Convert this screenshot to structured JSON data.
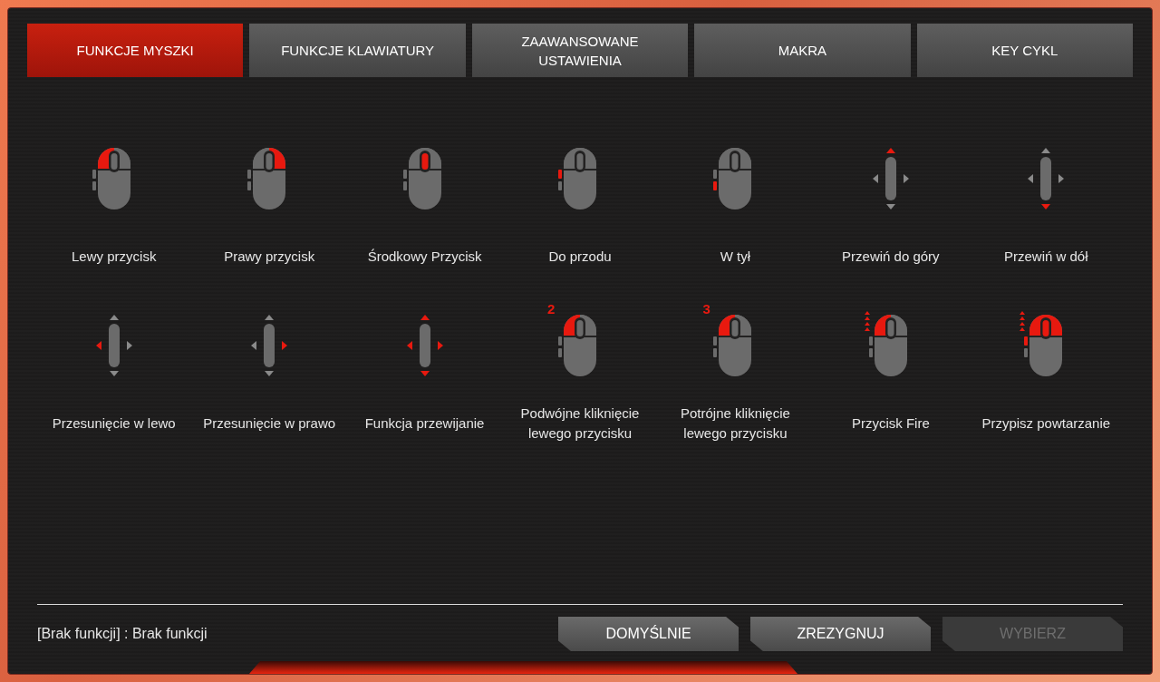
{
  "tabs": [
    {
      "label": "FUNKCJE MYSZKI",
      "selected": true
    },
    {
      "label": "FUNKCJE KLAWIATURY",
      "selected": false
    },
    {
      "label": "ZAAWANSOWANE USTAWIENIA",
      "selected": false
    },
    {
      "label": "MAKRA",
      "selected": false
    },
    {
      "label": "KEY CYKL",
      "selected": false
    }
  ],
  "functions": [
    {
      "label": "Lewy przycisk",
      "icon": {
        "kind": "mouse",
        "left": true,
        "right": false,
        "wheel": false,
        "forward": false,
        "back": false,
        "fire": false
      }
    },
    {
      "label": "Prawy przycisk",
      "icon": {
        "kind": "mouse",
        "left": false,
        "right": true,
        "wheel": false,
        "forward": false,
        "back": false,
        "fire": false
      }
    },
    {
      "label": "Środkowy Przycisk",
      "icon": {
        "kind": "mouse",
        "left": false,
        "right": false,
        "wheel": true,
        "forward": false,
        "back": false,
        "fire": false
      }
    },
    {
      "label": "Do przodu",
      "icon": {
        "kind": "mouse",
        "left": false,
        "right": false,
        "wheel": false,
        "forward": true,
        "back": false,
        "fire": false
      }
    },
    {
      "label": "W tył",
      "icon": {
        "kind": "mouse",
        "left": false,
        "right": false,
        "wheel": false,
        "forward": false,
        "back": true,
        "fire": false
      }
    },
    {
      "label": "Przewiń do góry",
      "icon": {
        "kind": "scroll",
        "up": true,
        "down": false,
        "left": false,
        "right": false
      }
    },
    {
      "label": "Przewiń w dół",
      "icon": {
        "kind": "scroll",
        "up": false,
        "down": true,
        "left": false,
        "right": false
      }
    },
    {
      "label": "Przesunięcie w lewo",
      "icon": {
        "kind": "scroll",
        "up": false,
        "down": false,
        "left": true,
        "right": false
      }
    },
    {
      "label": "Przesunięcie w prawo",
      "icon": {
        "kind": "scroll",
        "up": false,
        "down": false,
        "left": false,
        "right": true
      }
    },
    {
      "label": "Funkcja przewijanie",
      "icon": {
        "kind": "scroll",
        "up": true,
        "down": true,
        "left": true,
        "right": true
      }
    },
    {
      "label": "Podwójne kliknięcie lewego przycisku",
      "icon": {
        "kind": "mouse",
        "left": true,
        "right": false,
        "wheel": false,
        "forward": false,
        "back": false,
        "fire": false,
        "badge": "2"
      }
    },
    {
      "label": "Potrójne kliknięcie lewego przycisku",
      "icon": {
        "kind": "mouse",
        "left": true,
        "right": false,
        "wheel": false,
        "forward": false,
        "back": false,
        "fire": false,
        "badge": "3"
      }
    },
    {
      "label": "Przycisk Fire",
      "icon": {
        "kind": "mouse",
        "left": true,
        "right": false,
        "wheel": false,
        "forward": false,
        "back": false,
        "fire": true
      }
    },
    {
      "label": "Przypisz powtarzanie",
      "icon": {
        "kind": "mouse",
        "left": true,
        "right": true,
        "wheel": true,
        "forward": true,
        "back": false,
        "fire": true
      }
    }
  ],
  "status": "[Brak funkcji] : Brak funkcji",
  "buttons": [
    {
      "label": "DOMYŚLNIE",
      "disabled": false
    },
    {
      "label": "ZREZYGNUJ",
      "disabled": false
    },
    {
      "label": "WYBIERZ",
      "disabled": true
    }
  ]
}
